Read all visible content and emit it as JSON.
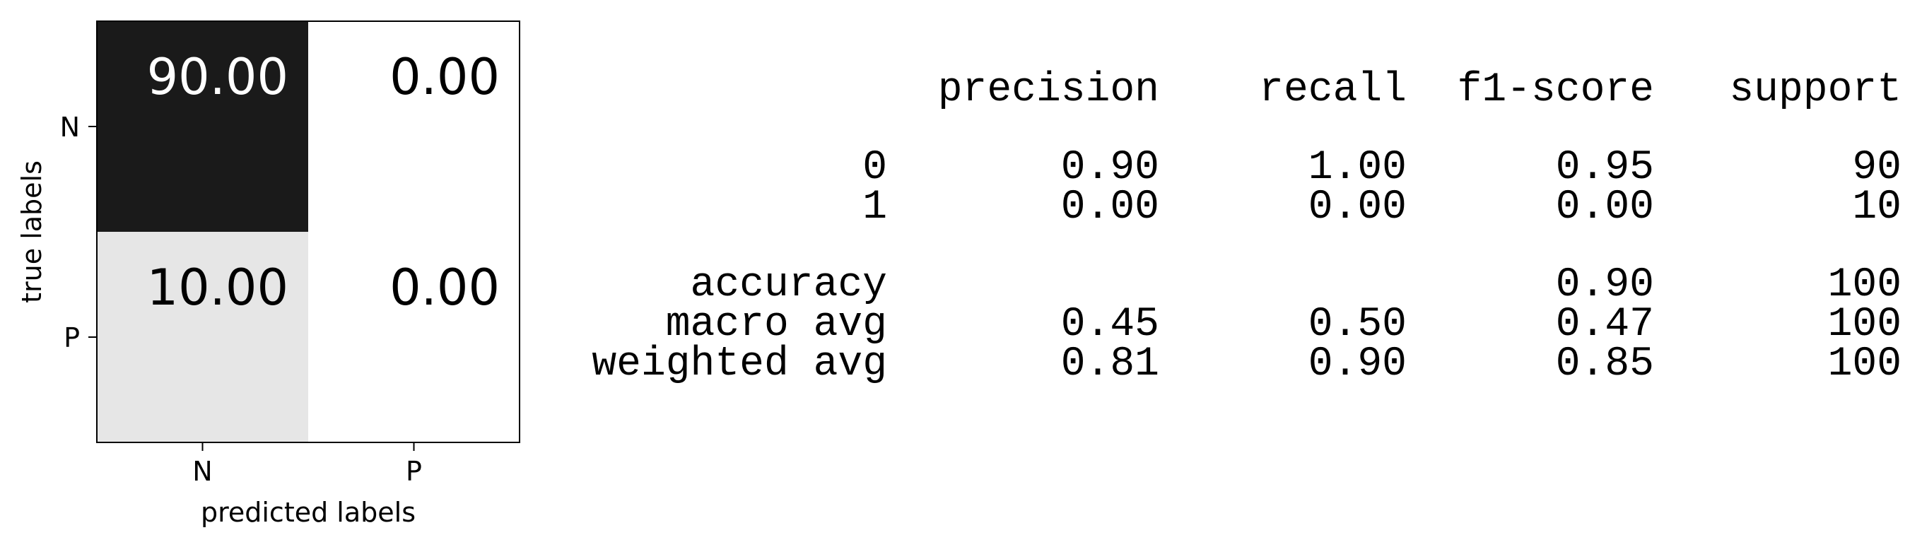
{
  "chart_data": [
    {
      "type": "heatmap",
      "x_categories": [
        "N",
        "P"
      ],
      "y_categories": [
        "N",
        "P"
      ],
      "values": [
        [
          90.0,
          0.0
        ],
        [
          10.0,
          0.0
        ]
      ],
      "value_labels": [
        [
          "90.00",
          "0.00"
        ],
        [
          "10.00",
          "0.00"
        ]
      ],
      "xlabel": "predicted labels",
      "ylabel": "true labels",
      "vmin": 0,
      "vmax": 90,
      "colormap": "Greys",
      "grid": false
    },
    {
      "type": "table",
      "columns": [
        "precision",
        "recall",
        "f1-score",
        "support"
      ],
      "rows": [
        {
          "label": "0",
          "values": [
            "0.90",
            "1.00",
            "0.95",
            "90"
          ]
        },
        {
          "label": "1",
          "values": [
            "0.00",
            "0.00",
            "0.00",
            "10"
          ]
        },
        {
          "label": "accuracy",
          "values": [
            "",
            "",
            "0.90",
            "100"
          ]
        },
        {
          "label": "macro avg",
          "values": [
            "0.45",
            "0.50",
            "0.47",
            "100"
          ]
        },
        {
          "label": "weighted avg",
          "values": [
            "0.81",
            "0.90",
            "0.85",
            "100"
          ]
        }
      ]
    }
  ]
}
